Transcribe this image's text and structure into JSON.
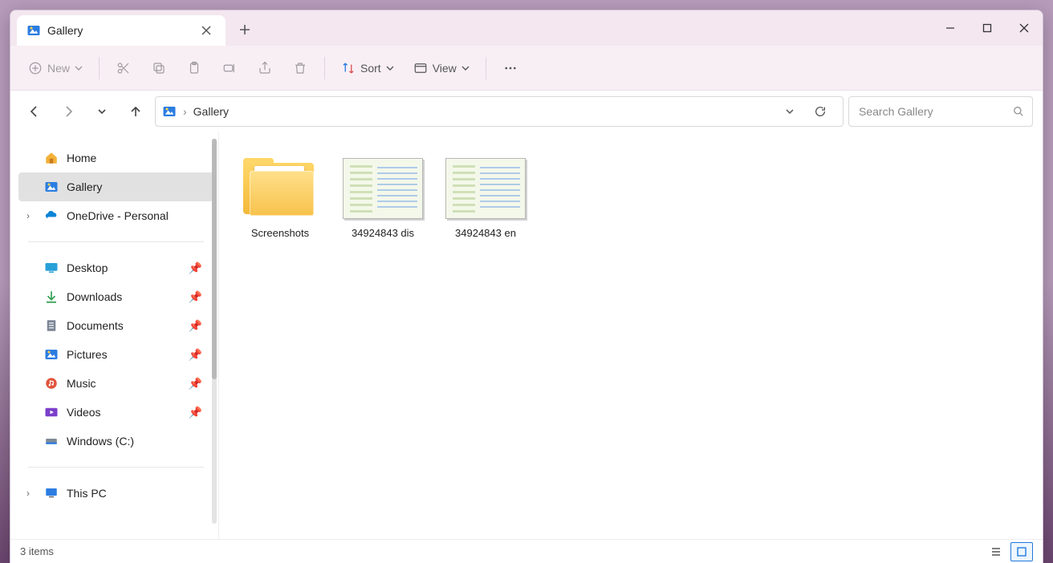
{
  "window": {
    "tab_title": "Gallery"
  },
  "toolbar": {
    "new_label": "New",
    "sort_label": "Sort",
    "view_label": "View"
  },
  "address": {
    "location": "Gallery"
  },
  "search": {
    "placeholder": "Search Gallery"
  },
  "sidebar": {
    "home": "Home",
    "gallery": "Gallery",
    "onedrive": "OneDrive - Personal",
    "quick": {
      "desktop": "Desktop",
      "downloads": "Downloads",
      "documents": "Documents",
      "pictures": "Pictures",
      "music": "Music",
      "videos": "Videos",
      "drive_c": "Windows (C:)"
    },
    "this_pc": "This PC"
  },
  "items": [
    {
      "type": "folder",
      "name": "Screenshots"
    },
    {
      "type": "image",
      "name": "34924843 dis"
    },
    {
      "type": "image",
      "name": "34924843 en"
    }
  ],
  "status": {
    "count_text": "3 items"
  }
}
